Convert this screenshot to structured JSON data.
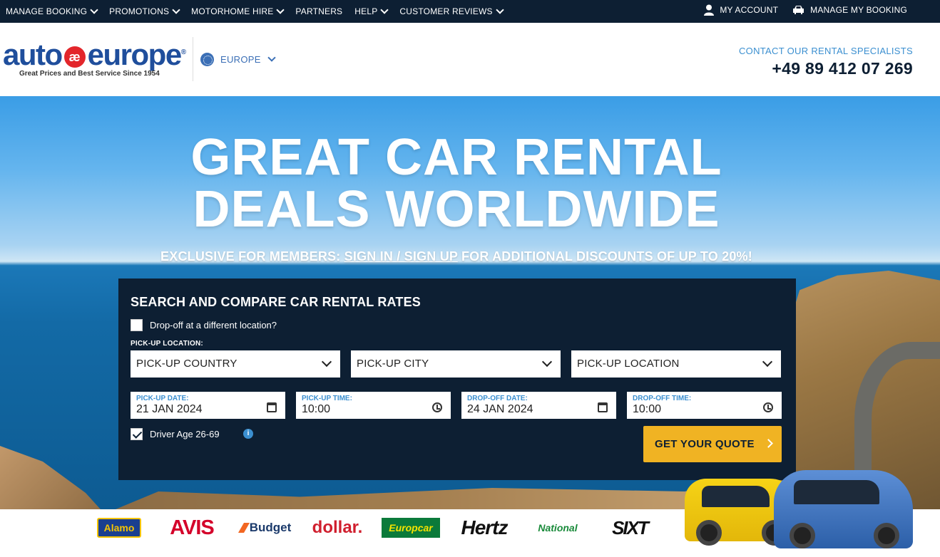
{
  "topnav": {
    "items": [
      "MANAGE BOOKING",
      "PROMOTIONS",
      "MOTORHOME HIRE",
      "PARTNERS",
      "HELP",
      "CUSTOMER REVIEWS"
    ],
    "my_account": "MY ACCOUNT",
    "manage_my_booking": "MANAGE MY BOOKING"
  },
  "header": {
    "logo_left": "auto",
    "logo_mark": "æ",
    "logo_right": "europe",
    "logo_reg": "®",
    "tagline": "Great Prices and Best Service Since 1954",
    "region": "EUROPE",
    "contact_label": "CONTACT OUR RENTAL SPECIALISTS",
    "phone": "+49 89 412 07 269"
  },
  "hero": {
    "title_line1": "GREAT CAR RENTAL",
    "title_line2": "DEALS WORLDWIDE",
    "members_pre": "EXCLUSIVE FOR MEMBERS:",
    "members_link": "SIGN IN / SIGN UP",
    "members_post": "FOR ADDITIONAL DISCOUNTS OF UP TO 20%!"
  },
  "search": {
    "title": "SEARCH AND COMPARE CAR RENTAL RATES",
    "dropoff_diff_label": "Drop-off at a different location?",
    "pickup_location_label": "PICK-UP LOCATION:",
    "pickup_country": "PICK-UP COUNTRY",
    "pickup_city": "PICK-UP CITY",
    "pickup_location": "PICK-UP LOCATION",
    "pickup_date_label": "PICK-UP DATE:",
    "pickup_date": "21 JAN 2024",
    "pickup_time_label": "PICK-UP TIME:",
    "pickup_time": "10:00",
    "dropoff_date_label": "DROP-OFF DATE:",
    "dropoff_date": "24 JAN 2024",
    "dropoff_time_label": "DROP-OFF TIME:",
    "dropoff_time": "10:00",
    "driver_age": "Driver Age 26-69",
    "info": "i",
    "quote_button": "GET YOUR QUOTE"
  },
  "brands": [
    "Alamo",
    "AVIS",
    "Budget",
    "dollar.",
    "Europcar",
    "Hertz",
    "National",
    "SIXT"
  ]
}
